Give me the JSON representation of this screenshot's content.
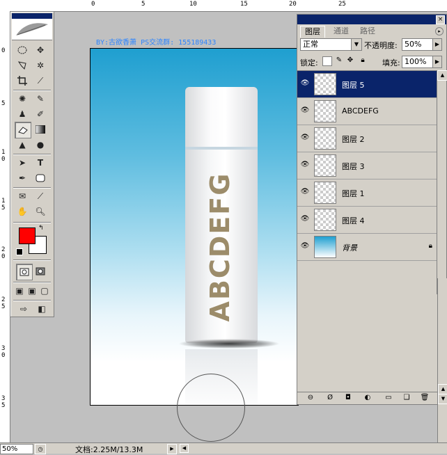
{
  "ruler": {
    "top_labels": [
      "0",
      "5",
      "10",
      "15",
      "20",
      "25"
    ],
    "left_labels": [
      "0",
      "5",
      "1",
      "0",
      "1",
      "5",
      "2",
      "0",
      "2",
      "5",
      "3",
      "0",
      "3",
      "5"
    ]
  },
  "credit": "BY:古欲香萧 PS交流群: 155189433",
  "bottle_text": "ABCDEFG",
  "colors": {
    "foreground": "#ff0000",
    "background": "#ffffff",
    "selection": "#0a246a",
    "bottle_text": "#9c8c6a"
  },
  "tools": [
    "rectangle-select",
    "move",
    "lasso",
    "magic-wand",
    "crop",
    "slice",
    "healing-brush",
    "brush",
    "clone-stamp",
    "history-brush",
    "eraser",
    "gradient",
    "blur",
    "dodge",
    "path-select",
    "type",
    "pen",
    "rectangle-shape",
    "notes",
    "eyedropper",
    "hand",
    "zoom"
  ],
  "layers_panel": {
    "tabs": [
      "图层",
      "通道",
      "路径"
    ],
    "close_label": "×",
    "blend_mode": "正常",
    "opacity_label": "不透明度:",
    "opacity_value": "50%",
    "lock_label": "锁定:",
    "fill_label": "填充:",
    "fill_value": "100%",
    "layers": [
      {
        "name": "图层 5",
        "selected": true
      },
      {
        "name": "ABCDEFG",
        "selected": false
      },
      {
        "name": "图层 2",
        "selected": false
      },
      {
        "name": "图层 3",
        "selected": false
      },
      {
        "name": "图层 1",
        "selected": false
      },
      {
        "name": "图层 4",
        "selected": false
      },
      {
        "name": "背景",
        "selected": false,
        "locked": true
      }
    ]
  },
  "status": {
    "zoom": "50%",
    "doc_size": "文档:2.25M/13.3M"
  }
}
